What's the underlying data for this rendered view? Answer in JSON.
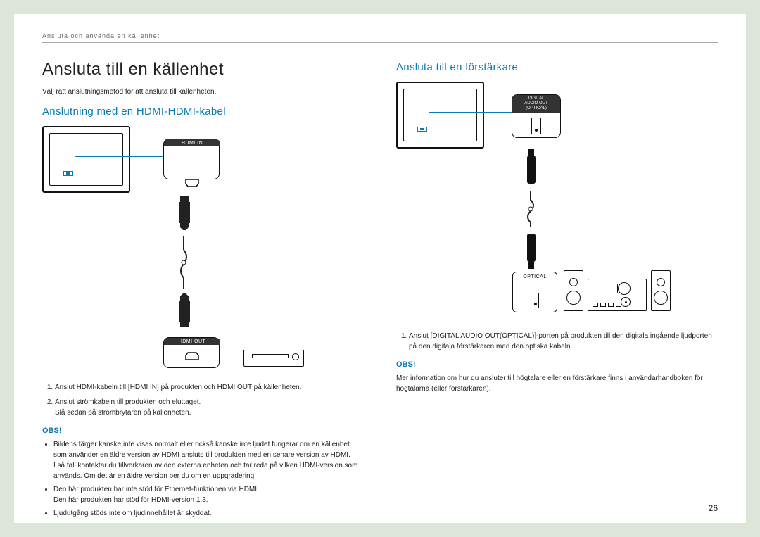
{
  "breadcrumb": "Ansluta och använda en källenhet",
  "page_number": "26",
  "left": {
    "h1": "Ansluta till en källenhet",
    "intro": "Välj rätt anslutningsmetod för att ansluta till källenheten.",
    "h2": "Anslutning med en HDMI-HDMI-kabel",
    "label_hdmi_in": "HDMI IN",
    "label_hdmi_out": "HDMI OUT",
    "steps": [
      "Anslut HDMI-kabeln till [HDMI IN] på produkten och HDMI OUT på källenheten.",
      "Anslut strömkabeln till produkten och eluttaget.\nSlå sedan på strömbrytaren på källenheten."
    ],
    "obs": "OBS!",
    "notes": [
      "Bildens färger kanske inte visas normalt eller också kanske inte ljudet fungerar om en källenhet som använder en äldre version av HDMI ansluts till produkten med en senare version av HDMI.\nI så fall kontaktar du tillverkaren av den externa enheten och tar reda på vilken HDMI-version som används. Om det är en äldre version ber du om en uppgradering.",
      "Den här produkten har inte stöd för Ethernet-funktionen via HDMI.\nDen här produkten har stöd för HDMI-version 1.3.",
      "Ljudutgång stöds inte om ljudinnehållet är skyddat."
    ]
  },
  "right": {
    "h2": "Ansluta till en förstärkare",
    "label_digital_1": "DIGITAL",
    "label_digital_2": "AUDIO OUT",
    "label_digital_3": "(OPTICAL)",
    "label_optical": "OPTICAL",
    "steps": [
      "Anslut [DIGITAL AUDIO OUT(OPTICAL)]-porten på produkten till den digitala ingående ljudporten på den digitala förstärkaren med den optiska kabeln."
    ],
    "obs": "OBS!",
    "note_text": "Mer information om hur du ansluter till högtalare eller en förstärkare finns i användarhandboken för högtalarna (eller förstärkaren)."
  }
}
